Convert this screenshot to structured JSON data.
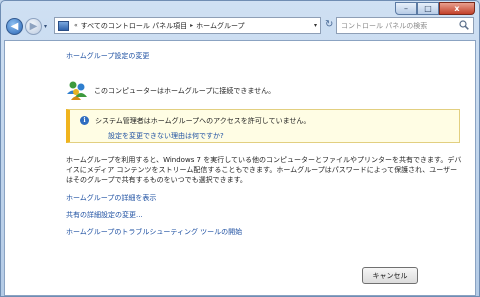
{
  "window": {
    "minimize": "–",
    "maximize": "□",
    "close": "x"
  },
  "nav": {
    "back": "◀",
    "forward": "▶",
    "dropdown": "▾"
  },
  "address": {
    "chevron": "«",
    "crumb1": "すべてのコントロール パネル項目",
    "sep": "▸",
    "crumb2": "ホームグループ",
    "dropdown": "▾",
    "refresh": "↻"
  },
  "search": {
    "placeholder": "コントロール パネルの検索"
  },
  "content": {
    "settings_link": "ホームグループ設定の変更",
    "status": "このコンピューターはホームグループに接続できません。",
    "info_icon": "i",
    "info_message": "システム管理者はホームグループへのアクセスを許可していません。",
    "info_link": "設定を変更できない理由は何ですか?",
    "description": "ホームグループを利用すると、Windows 7 を実行している他のコンピューターとファイルやプリンターを共有できます。デバイスにメディア コンテンツをストリーム配信することもできます。ホームグループはパスワードによって保護され、ユーザーはそのグループで共有するものをいつでも選択できます。",
    "links": [
      "ホームグループの詳細を表示",
      "共有の詳細設定の変更...",
      "ホームグループのトラブルシューティング ツールの開始"
    ]
  },
  "buttons": {
    "cancel": "キャンセル"
  }
}
